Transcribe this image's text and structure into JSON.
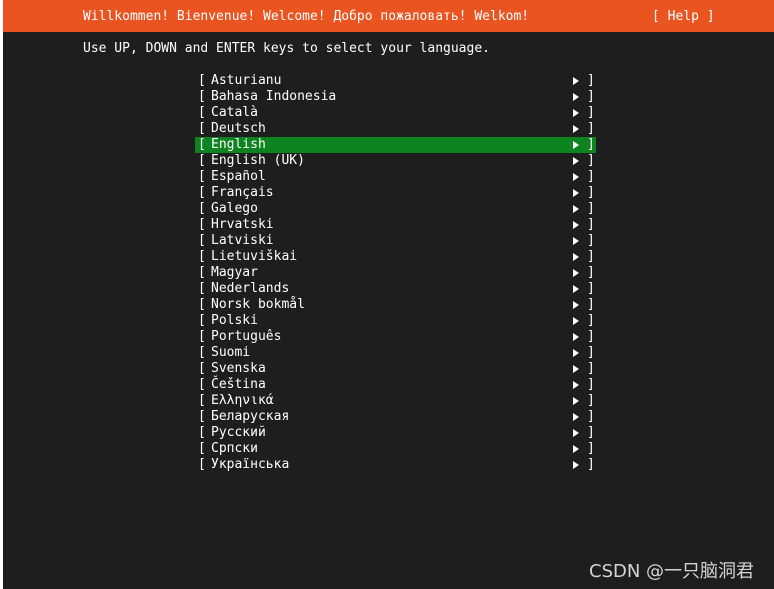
{
  "header": {
    "title": "Willkommen! Bienvenue! Welcome! Добро пожаловать! Welkom!",
    "help_label": "[ Help ]"
  },
  "instruction": "Use UP, DOWN and ENTER keys to select your language.",
  "bracket_open": "[",
  "bracket_close": "]",
  "languages": [
    {
      "label": "Asturianu"
    },
    {
      "label": "Bahasa Indonesia"
    },
    {
      "label": "Català"
    },
    {
      "label": "Deutsch"
    },
    {
      "label": "English",
      "selected": true
    },
    {
      "label": "English (UK)"
    },
    {
      "label": "Español"
    },
    {
      "label": "Français"
    },
    {
      "label": "Galego"
    },
    {
      "label": "Hrvatski"
    },
    {
      "label": "Latviski"
    },
    {
      "label": "Lietuviškai"
    },
    {
      "label": "Magyar"
    },
    {
      "label": "Nederlands"
    },
    {
      "label": "Norsk bokmål"
    },
    {
      "label": "Polski"
    },
    {
      "label": "Português"
    },
    {
      "label": "Suomi"
    },
    {
      "label": "Svenska"
    },
    {
      "label": "Čeština"
    },
    {
      "label": "Ελληνικά"
    },
    {
      "label": "Беларуская"
    },
    {
      "label": "Русский"
    },
    {
      "label": "Српски"
    },
    {
      "label": "Українська"
    }
  ],
  "watermark": "CSDN @一只脑洞君",
  "colors": {
    "header_bg": "#e95420",
    "screen_bg": "#1e1e1e",
    "selected_bg": "#0e8420",
    "text": "#ffffff"
  }
}
